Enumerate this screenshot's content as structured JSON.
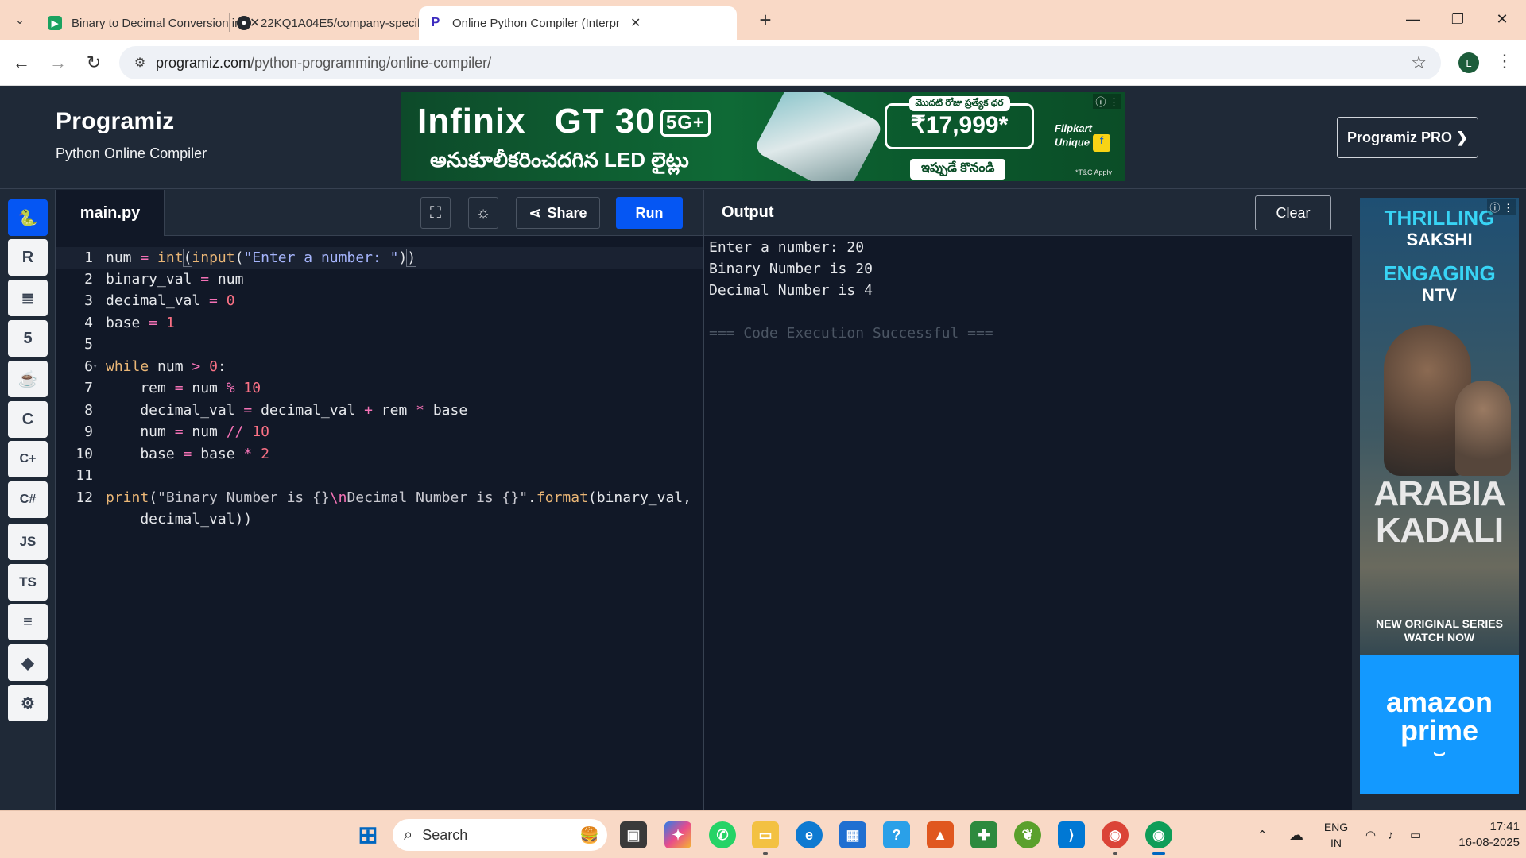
{
  "browser": {
    "tabs": [
      {
        "title": "Binary to Decimal Conversion in",
        "favicon_color": "#1aa260"
      },
      {
        "title": "22KQ1A04E5/company-specific",
        "favicon_color": "#24292f"
      },
      {
        "title": "Online Python Compiler (Interpr",
        "favicon_color": "#3c2bbf",
        "active": true
      }
    ],
    "url_host": "programiz.com",
    "url_path": "/python-programming/online-compiler/",
    "profile_initial": "L"
  },
  "header": {
    "logo": "Programiz",
    "subtitle": "Python Online Compiler",
    "pro_button": "Programiz PRO ❯"
  },
  "banner_ad": {
    "brand": "Infinix",
    "model": "GT 30",
    "badge": "5G+",
    "tagline": "అనుకూలీకరించదగిన LED లైట్లు",
    "price_caption": "మొదటి రోజు ప్రత్యేక ధర",
    "price": "₹17,999*",
    "cta": "ఇప్పుడే కొనండి",
    "partner": "Flipkart Unique",
    "terms": "*T&C Apply"
  },
  "rail": {
    "items": [
      "py",
      "R",
      "db",
      "5",
      "java",
      "C",
      "C++",
      "C#",
      "JS",
      "TS",
      "go",
      "swift",
      "rs"
    ]
  },
  "editor": {
    "file_name": "main.py",
    "share_label": "Share",
    "run_label": "Run"
  },
  "output": {
    "title": "Output",
    "clear_label": "Clear",
    "lines": [
      "Enter a number: 20",
      "Binary Number is 20",
      "Decimal Number is 4",
      "",
      "=== Code Execution Successful ==="
    ]
  },
  "side_ad": {
    "line1a": "THRILLING",
    "line1b": "SAKSHI",
    "line2a": "ENGAGING",
    "line2b": "NTV",
    "film1": "ARABIA",
    "film2": "KADALI",
    "series1": "NEW ORIGINAL SERIES",
    "series2": "WATCH NOW",
    "prime1": "amazon",
    "prime2": "prime"
  },
  "taskbar": {
    "search_placeholder": "Search",
    "lang1": "ENG",
    "lang2": "IN",
    "time": "17:41",
    "date": "16-08-2025"
  }
}
